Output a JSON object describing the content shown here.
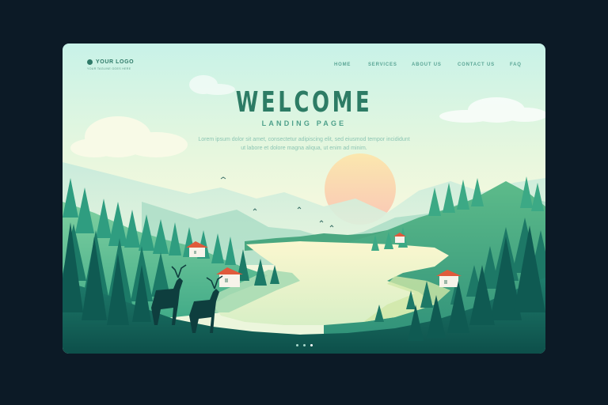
{
  "logo": {
    "text": "YOUR LOGO",
    "tagline": "YOUR TAGLINE GOES HERE"
  },
  "nav": {
    "items": [
      {
        "label": "HOME"
      },
      {
        "label": "SERVICES"
      },
      {
        "label": "ABOUT US"
      },
      {
        "label": "CONTACT US"
      },
      {
        "label": "FAQ"
      }
    ]
  },
  "hero": {
    "title": "WELCOME",
    "subtitle": "LANDING PAGE",
    "description": "Lorem ipsum dolor sit amet, consectetur adipiscing elit, sed eiusmod tempor incididunt ut labore et dolore magna aliqua, ut enim ad minim."
  },
  "pagination": {
    "count": 3,
    "active_index": 2
  },
  "colors": {
    "page_background": "#0c1a26",
    "accent": "#2d7c65",
    "sun": "#fbd7b0",
    "lake": "#f6f5c8",
    "house_roof": "#e05a3c",
    "forest_dark": "#0f5a52",
    "forest_mid": "#2f9d80"
  }
}
